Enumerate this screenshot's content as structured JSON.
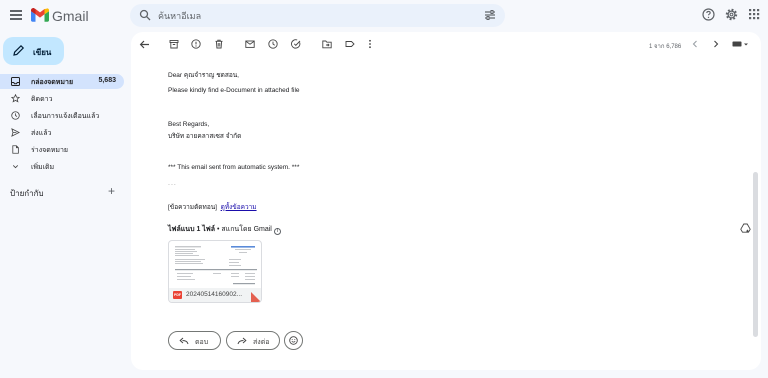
{
  "app": {
    "name": "Gmail"
  },
  "search": {
    "placeholder": "ค้นหาอีเมล"
  },
  "compose": {
    "label": "เขียน"
  },
  "sidebar": {
    "items": [
      {
        "label": "กล่องจดหมาย",
        "count": "5,683",
        "icon": "inbox-icon",
        "active": true
      },
      {
        "label": "ติดดาว",
        "count": "",
        "icon": "star-icon"
      },
      {
        "label": "เลื่อนการแจ้งเตือนแล้ว",
        "count": "",
        "icon": "clock-icon"
      },
      {
        "label": "ส่งแล้ว",
        "count": "",
        "icon": "send-icon"
      },
      {
        "label": "ร่างจดหมาย",
        "count": "",
        "icon": "draft-icon"
      },
      {
        "label": "เพิ่มเติม",
        "count": "",
        "icon": "chevron-down-icon"
      }
    ],
    "labels_heading": "ป้ายกำกับ",
    "labels_add": "+"
  },
  "toolbar": {
    "pager": "1 จาก 6,786"
  },
  "email": {
    "greeting": "Dear คุณจำราญ ชดสอน,",
    "line1": "Please kindly find e-Document in attached file",
    "regards": "Best Regards,",
    "company": "บริษัท อายคลาสเซส จำกัด",
    "notice": "*** This email sent from automatic system. ***",
    "quote_dots": "...",
    "clipped_prefix": "[ข้อความตัดทอน]",
    "clipped_link": "ดูทั้งข้อความ"
  },
  "attachments": {
    "heading": "ไฟล์แนบ 1 ไฟล์",
    "scan_note": "• สแกนโดย Gmail",
    "file": {
      "name": "20240514160902...",
      "type_label": "PDF"
    }
  },
  "actions": {
    "reply": "ตอบ",
    "forward": "ส่งต่อ"
  },
  "colors": {
    "accent": "#c2e7ff",
    "active_nav": "#d3e3fd",
    "link": "#1a0dab"
  }
}
